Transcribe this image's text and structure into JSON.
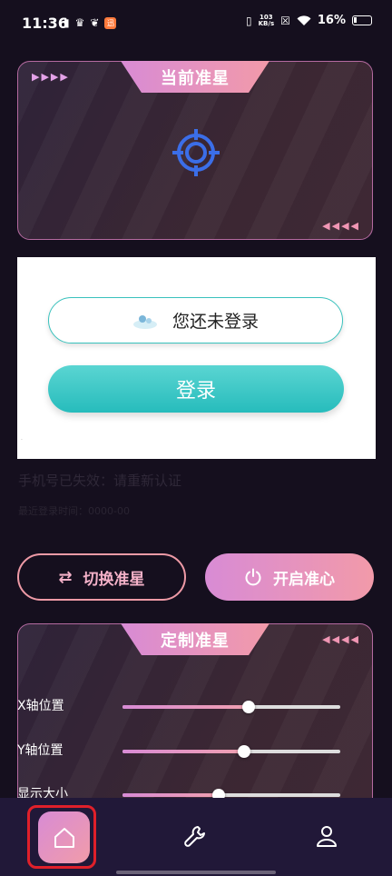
{
  "status_bar": {
    "time": "11:36",
    "badge": "迅",
    "net_speed_value": "103",
    "net_speed_unit": "KB/s",
    "battery": "16%"
  },
  "current_crosshair": {
    "title": "当前准星",
    "left_arrows": "▶▶▶▶",
    "right_arrows": "◀◀◀◀"
  },
  "login": {
    "status_text": "您还未登录",
    "button_label": "登录"
  },
  "phone_message": "手机号已失效：请重新认证",
  "ghost_text": "最近登录时间：0000-00",
  "actions": {
    "switch_label": "切换准星",
    "start_label": "开启准心"
  },
  "custom_crosshair": {
    "title": "定制准星",
    "right_arrows": "◀◀◀◀",
    "sliders": [
      {
        "label": "X轴位置",
        "value": 0.58
      },
      {
        "label": "Y轴位置",
        "value": 0.56
      },
      {
        "label": "显示大小",
        "value": 0.44
      }
    ]
  },
  "colors": {
    "accent_gradient_start": "#d88bd5",
    "accent_gradient_end": "#f29aa9",
    "login_teal": "#27bcbc",
    "crosshair_blue": "#3b6ee8",
    "background": "#150f1e"
  },
  "nav": [
    {
      "icon": "home-icon",
      "active": true
    },
    {
      "icon": "wrench-icon",
      "active": false
    },
    {
      "icon": "user-icon",
      "active": false
    }
  ]
}
